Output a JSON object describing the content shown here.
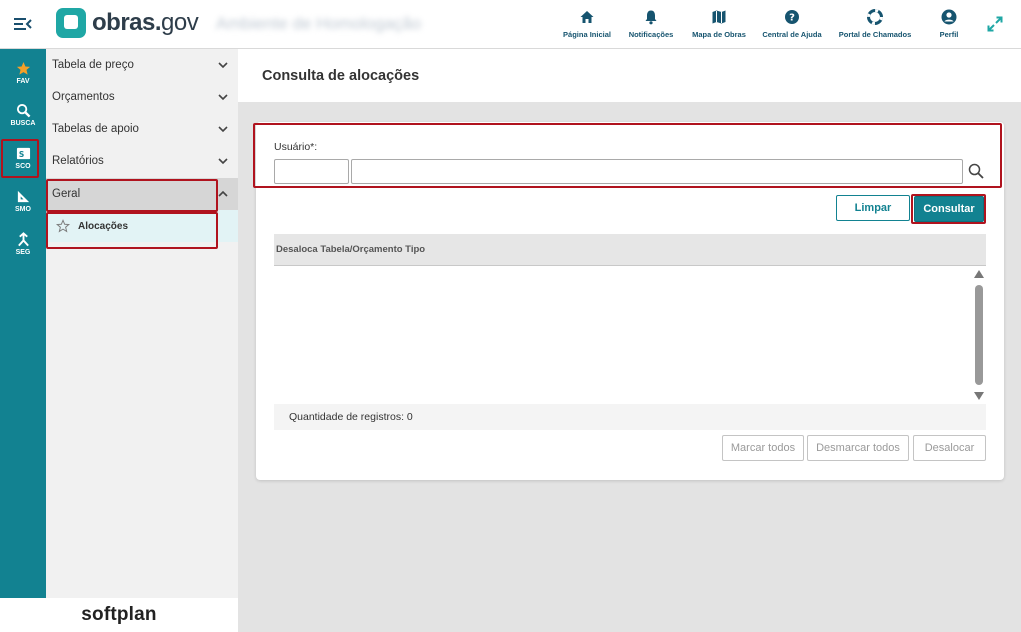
{
  "app": {
    "logo_text_bold": "obras.",
    "logo_text_light": "gov",
    "environment_label": "Ambiente de Homologação"
  },
  "top_nav": [
    {
      "label": "Página Inicial",
      "icon": "home-icon"
    },
    {
      "label": "Notificações",
      "icon": "bell-icon"
    },
    {
      "label": "Mapa de Obras",
      "icon": "map-icon"
    },
    {
      "label": "Central de Ajuda",
      "icon": "help-icon"
    },
    {
      "label": "Portal de Chamados",
      "icon": "lifebuoy-icon"
    },
    {
      "label": "Perfil",
      "icon": "user-icon"
    }
  ],
  "rail": [
    {
      "label": "FAV",
      "icon": "star-icon"
    },
    {
      "label": "BUSCA",
      "icon": "search-icon"
    },
    {
      "label": "SCO",
      "icon": "sco-icon"
    },
    {
      "label": "SMO",
      "icon": "ruler-triangle-icon"
    },
    {
      "label": "SEG",
      "icon": "seg-icon"
    }
  ],
  "sidebar": {
    "items": [
      {
        "label": "Tabela de preço"
      },
      {
        "label": "Orçamentos"
      },
      {
        "label": "Tabelas de apoio"
      },
      {
        "label": "Relatórios"
      },
      {
        "label": "Geral"
      }
    ],
    "sub_item": {
      "label": "Alocações"
    }
  },
  "footer_brand": "softplan",
  "page": {
    "title": "Consulta de alocações",
    "usuario_label": "Usuário*:",
    "usuario_code_value": "",
    "usuario_name_value": "",
    "limpar_label": "Limpar",
    "consultar_label": "Consultar",
    "grid_header": "Desaloca Tabela/Orçamento Tipo",
    "record_count_label": "Quantidade de registros: 0",
    "marcar_todos_label": "Marcar todos",
    "desmarcar_todos_label": "Desmarcar todos",
    "desalocar_label": "Desalocar"
  },
  "colors": {
    "rail": "#128291",
    "accent": "#1fa7a5",
    "highlight": "#b0131e"
  }
}
